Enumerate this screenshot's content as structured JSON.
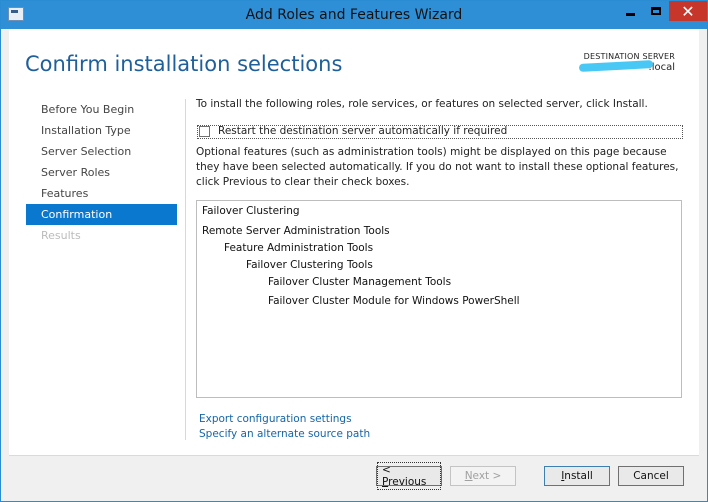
{
  "window": {
    "title": "Add Roles and Features Wizard",
    "controls": [
      "minimize-icon",
      "maximize-icon",
      "close-icon"
    ],
    "close_glyph": "✕",
    "accent": "#2f8fd6",
    "close_color": "#c7362b"
  },
  "header": {
    "page_title": "Confirm installation selections",
    "destination_label": "DESTINATION SERVER",
    "destination_server": ".local"
  },
  "nav": {
    "items": [
      {
        "label": "Before You Begin",
        "state": "normal"
      },
      {
        "label": "Installation Type",
        "state": "normal"
      },
      {
        "label": "Server Selection",
        "state": "normal"
      },
      {
        "label": "Server Roles",
        "state": "normal"
      },
      {
        "label": "Features",
        "state": "normal"
      },
      {
        "label": "Confirmation",
        "state": "active"
      },
      {
        "label": "Results",
        "state": "disabled"
      }
    ],
    "active_color": "#0a78cf"
  },
  "main": {
    "intro": "To install the following roles, role services, or features on selected server, click Install.",
    "restart_checkbox": {
      "label": "Restart the destination server automatically if required",
      "checked": false
    },
    "optional_text": "Optional features (such as administration tools) might be displayed on this page because they have been selected automatically. If you do not want to install these optional features, click Previous to clear their check boxes.",
    "selections": [
      {
        "label": "Failover Clustering",
        "level": 0
      },
      {
        "label": "Remote Server Administration Tools",
        "level": 0
      },
      {
        "label": "Feature Administration Tools",
        "level": 1
      },
      {
        "label": "Failover Clustering Tools",
        "level": 2
      },
      {
        "label": "Failover Cluster Management Tools",
        "level": 3
      },
      {
        "label": "Failover Cluster Module for Windows PowerShell",
        "level": 3
      }
    ],
    "links": {
      "export": "Export configuration settings",
      "alternate_source": "Specify an alternate source path"
    }
  },
  "footer": {
    "previous": {
      "prefix": "< ",
      "mnemonic": "P",
      "rest": "revious",
      "enabled": true
    },
    "next": {
      "prefix": "",
      "mnemonic": "N",
      "rest": "ext >",
      "enabled": false
    },
    "install": {
      "prefix": "",
      "mnemonic": "I",
      "rest": "nstall",
      "enabled": true
    },
    "cancel": {
      "label": "Cancel",
      "enabled": true
    }
  }
}
